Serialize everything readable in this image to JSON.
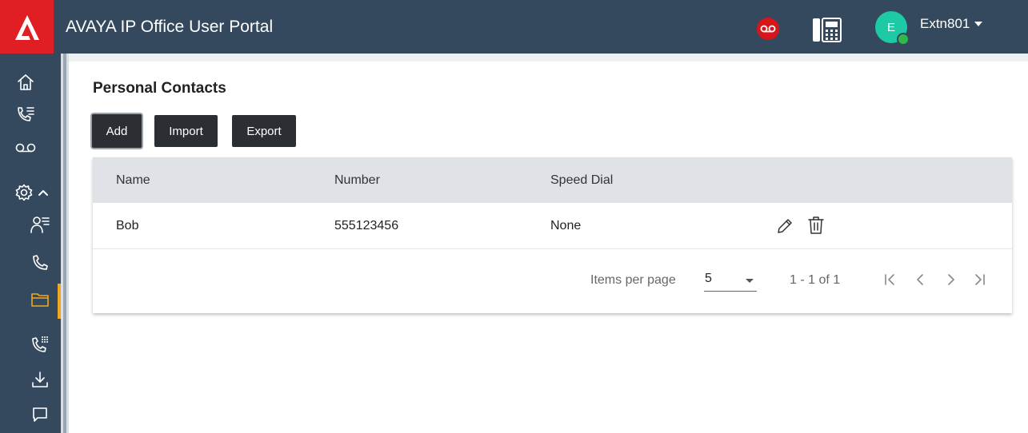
{
  "app": {
    "title": "AVAYA IP Office User Portal",
    "brand_color": "#e01e24",
    "header_color": "#34495e"
  },
  "header": {
    "voicemail_icon": "voicemail-icon",
    "phone_icon": "desk-phone-icon",
    "avatar_initial": "E",
    "username": "Extn801"
  },
  "sidebar": {
    "items": [
      {
        "icon": "home-icon"
      },
      {
        "icon": "call-log-icon"
      },
      {
        "icon": "voicemail-icon"
      },
      {
        "icon": "settings-icon",
        "expanded": true
      },
      {
        "icon": "user-profile-icon"
      },
      {
        "icon": "phone-icon"
      },
      {
        "icon": "folder-icon",
        "active": true
      },
      {
        "icon": "dialpad-icon"
      },
      {
        "icon": "download-icon"
      },
      {
        "icon": "chat-icon"
      }
    ],
    "active_color": "#f0a820"
  },
  "main": {
    "title": "Personal Contacts",
    "buttons": {
      "add": "Add",
      "import": "Import",
      "export": "Export"
    },
    "table": {
      "columns": [
        "Name",
        "Number",
        "Speed Dial"
      ],
      "rows": [
        {
          "name": "Bob",
          "number": "555123456",
          "speed_dial": "None"
        }
      ]
    },
    "pagination": {
      "items_per_page_label": "Items per page",
      "items_per_page": "5",
      "range": "1 - 1 of 1"
    }
  }
}
